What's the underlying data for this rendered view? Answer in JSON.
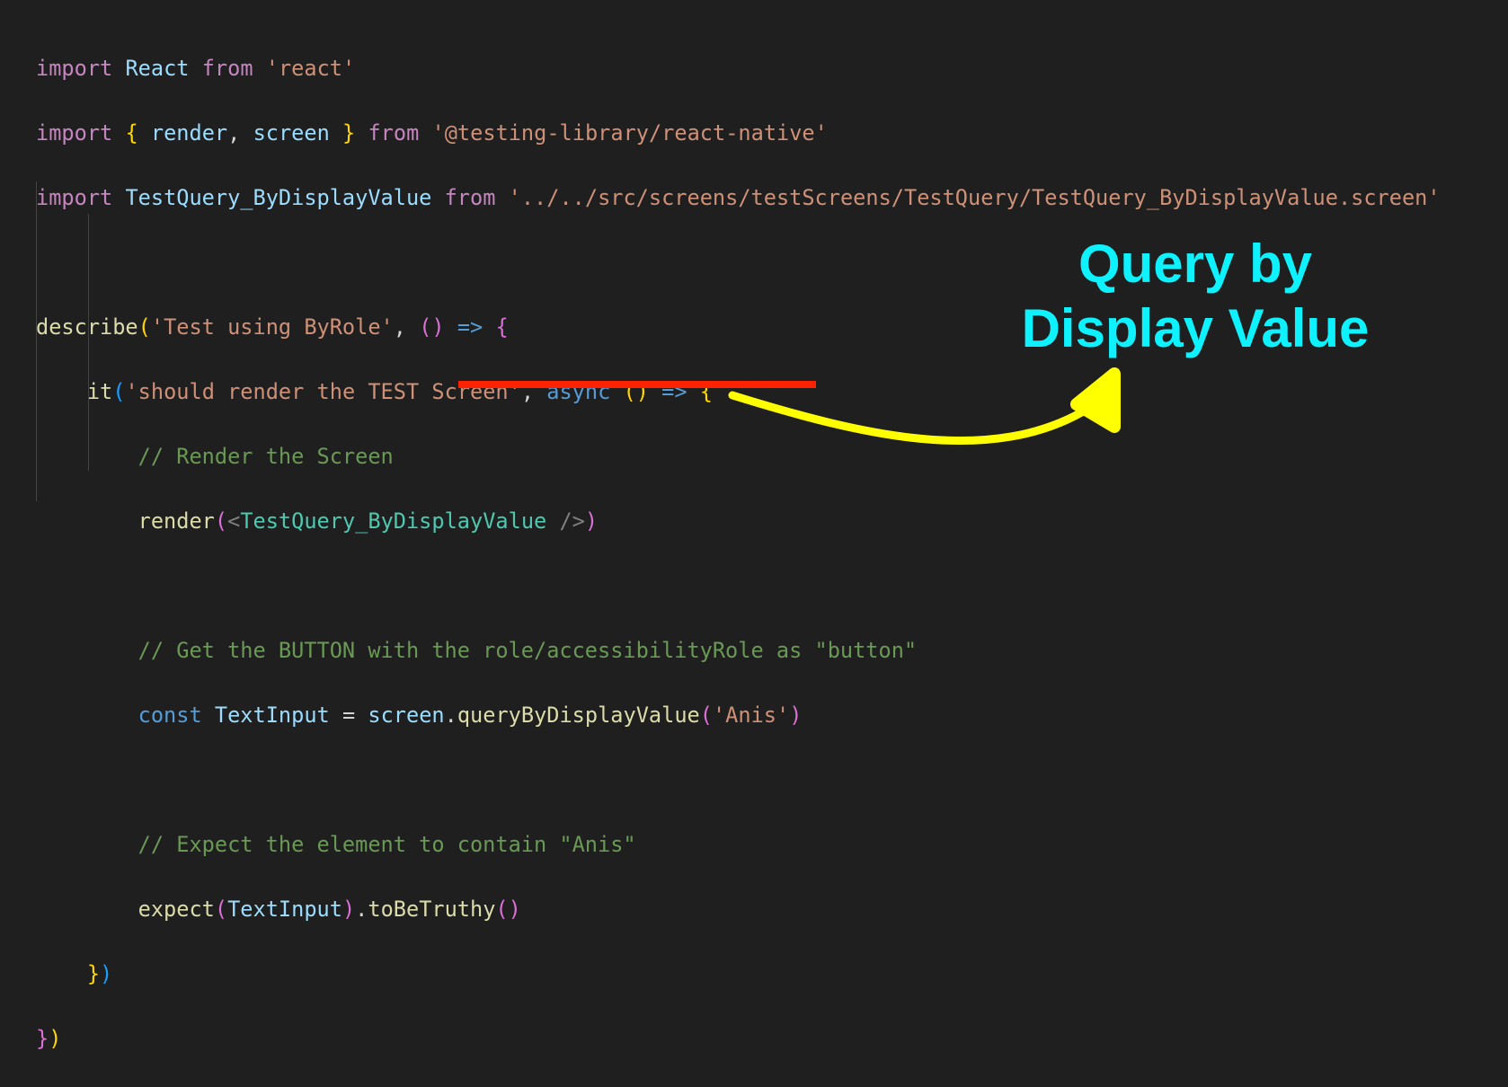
{
  "code": {
    "line1": {
      "import": "import",
      "name": "React",
      "from": "from",
      "module": "'react'"
    },
    "line2": {
      "import": "import",
      "open": "{",
      "a": "render",
      "comma": ",",
      "b": "screen",
      "close": "}",
      "from": "from",
      "module": "'@testing-library/react-native'"
    },
    "line3": {
      "import": "import",
      "name": "TestQuery_ByDisplayValue",
      "from": "from",
      "module": "'../../src/screens/testScreens/TestQuery/TestQuery_ByDisplayValue.screen'"
    },
    "line5": {
      "fn": "describe",
      "open": "(",
      "str": "'Test using ByRole'",
      "comma": ",",
      "params": "()",
      "arrow": "=>",
      "brace": "{"
    },
    "line6": {
      "fn": "it",
      "open": "(",
      "str": "'should render the TEST Screen'",
      "comma": ",",
      "async": "async",
      "params": "()",
      "arrow": "=>",
      "brace": "{"
    },
    "line7": {
      "comment": "// Render the Screen"
    },
    "line8": {
      "fn": "render",
      "open": "(",
      "lt": "<",
      "comp": "TestQuery_ByDisplayValue",
      "end": "/>",
      "close": ")"
    },
    "line10": {
      "comment": "// Get the BUTTON with the role/accessibilityRole as \"button\""
    },
    "line11": {
      "const": "const",
      "name": "TextInput",
      "eq": "=",
      "obj": "screen",
      "dot": ".",
      "method": "queryByDisplayValue",
      "open": "(",
      "str": "'Anis'",
      "close": ")"
    },
    "line13": {
      "comment": "// Expect the element to contain \"Anis\""
    },
    "line14": {
      "fn": "expect",
      "open": "(",
      "arg": "TextInput",
      "close": ")",
      "dot": ".",
      "method": "toBeTruthy",
      "call": "()"
    },
    "line15": {
      "brace": "}",
      "paren": ")"
    },
    "line16": {
      "brace": "}",
      "paren": ")"
    }
  },
  "annotation": {
    "line1": "Query by",
    "line2": "Display Value",
    "text_color": "#0ef2ff",
    "arrow_color": "#ffff00",
    "underline_color": "#ff2200"
  }
}
